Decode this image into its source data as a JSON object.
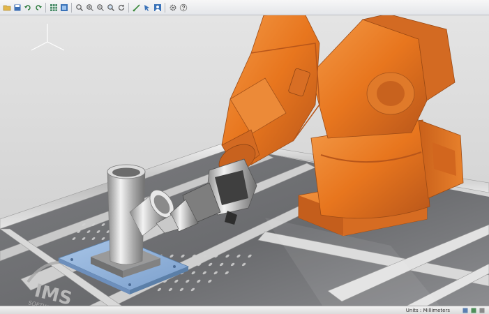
{
  "toolbar": {
    "buttons": [
      {
        "icon": "open-folder-icon"
      },
      {
        "icon": "save-icon"
      },
      {
        "icon": "undo-icon"
      },
      {
        "icon": "redo-icon"
      },
      {
        "icon": "grid-icon"
      },
      {
        "icon": "layers-icon"
      },
      {
        "icon": "zoom-icon"
      },
      {
        "icon": "zoom-in-icon"
      },
      {
        "icon": "zoom-out-icon"
      },
      {
        "icon": "zoom-fit-icon"
      },
      {
        "icon": "rotate-icon"
      },
      {
        "icon": "measure-icon"
      },
      {
        "icon": "select-icon"
      },
      {
        "icon": "user-icon"
      },
      {
        "icon": "settings-icon"
      },
      {
        "icon": "help-icon"
      }
    ]
  },
  "viewport": {
    "logo_text": "IMS",
    "logo_subtext": "SOFTWARE",
    "robot_color": "#e8761e",
    "fixture_color": "#8fb3dc",
    "table_color": "#6e6f72"
  },
  "statusbar": {
    "units_label": "Units : Millimeters"
  }
}
